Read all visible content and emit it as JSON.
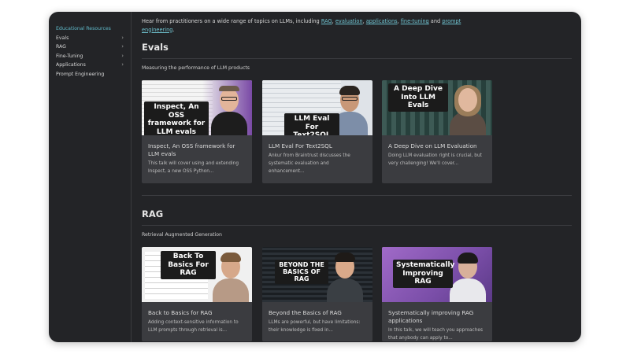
{
  "sidebar": {
    "items": [
      {
        "label": "Educational Resources",
        "chevron": false,
        "active": true
      },
      {
        "label": "Evals",
        "chevron": true
      },
      {
        "label": "RAG",
        "chevron": true
      },
      {
        "label": "Fine-Tuning",
        "chevron": true
      },
      {
        "label": "Applications",
        "chevron": true
      },
      {
        "label": "Prompt Engineering",
        "chevron": false
      }
    ],
    "chevron_glyph": "›"
  },
  "intro": {
    "text_before": "Hear from practitioners on a wide range of topics on LLMs, including ",
    "links": [
      "RAG",
      "evaluation",
      "applications",
      "fine-tuning",
      "prompt engineering"
    ],
    "sep1": ", ",
    "sep2": ", ",
    "sep3": ", ",
    "sep4": " and ",
    "end": "."
  },
  "sections": {
    "evals": {
      "title": "Evals",
      "subtitle": "Measuring the performance of LLM products",
      "cards": [
        {
          "thumb_text": "Inspect, An OSS framework for LLM evals",
          "title": "Inspect, An OSS framework for LLM evals",
          "desc": "This talk will cover using and extending Inspect, a new OSS Python..."
        },
        {
          "thumb_text": "LLM Eval For Text2SQL",
          "title": "LLM Eval For Text2SQL",
          "desc": "Ankur from Braintrust discusses the systematic evaluation and enhancement..."
        },
        {
          "thumb_text": "A Deep Dive Into LLM Evals",
          "title": "A Deep Dive on LLM Evaluation",
          "desc": "Doing LLM evaluation right is crucial, but very challenging! We'll cover..."
        }
      ]
    },
    "rag": {
      "title": "RAG",
      "subtitle": "Retrieval Augmented Generation",
      "cards": [
        {
          "thumb_text": "Back To Basics For RAG",
          "title": "Back to Basics for RAG",
          "desc": "Adding context-sensitive information to LLM prompts through retrieval is..."
        },
        {
          "thumb_text": "BEYOND THE BASICS OF RAG",
          "title": "Beyond the Basics of RAG",
          "desc": "LLMs are powerful, but have limitations: their knowledge is fixed in..."
        },
        {
          "thumb_text": "Systematically Improving RAG",
          "title": "Systematically improving RAG applications",
          "desc": "In this talk, we will teach you approaches that anybody can apply to..."
        }
      ]
    }
  },
  "colors": {
    "accent": "#5fb8c8",
    "background": "#232427",
    "card": "#3b3c40"
  }
}
